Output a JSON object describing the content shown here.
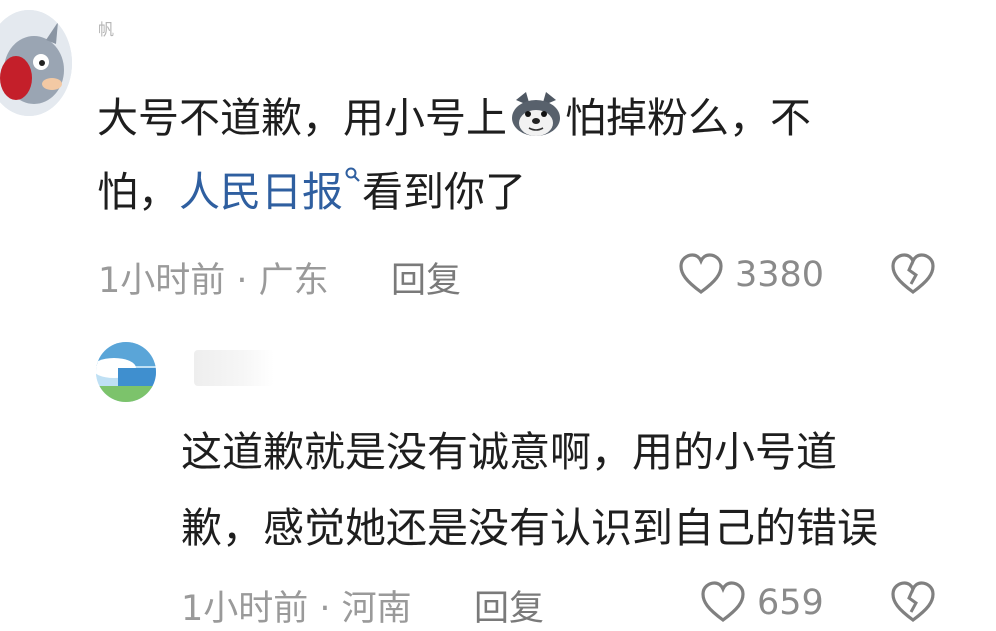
{
  "comments": [
    {
      "username": "帆",
      "text_before_emoji": "大号不道歉，用小号上",
      "emoji": "doge-emoji",
      "text_after_emoji": "怕掉粉么，不",
      "line2_prefix": "怕，",
      "mention": "人民日报",
      "line2_suffix": "看到你了",
      "meta": "1小时前 · 广东",
      "reply_label": "回复",
      "like_count": "3380"
    },
    {
      "line1": "这道歉就是没有诚意啊，用的小号道",
      "line2": "歉，感觉她还是没有认识到自己的错误",
      "meta": "1小时前 · 河南",
      "reply_label": "回复",
      "like_count": "659"
    }
  ],
  "icons": {
    "like": "heart-outline-icon",
    "dislike": "broken-heart-icon",
    "mention_search": "search-icon"
  },
  "colors": {
    "mention": "#2f5fa0",
    "meta": "#9a9a9a"
  }
}
